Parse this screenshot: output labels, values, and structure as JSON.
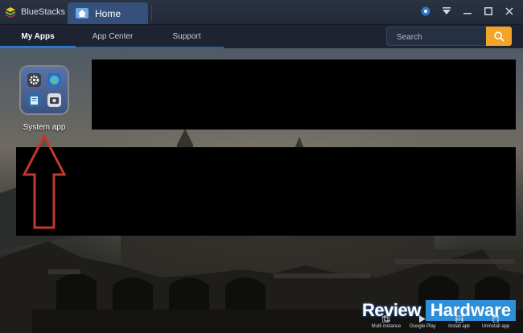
{
  "titlebar": {
    "app_name": "BlueStacks",
    "tab_label": "Home"
  },
  "nav": {
    "tabs": [
      {
        "label": "My Apps",
        "active": true
      },
      {
        "label": "App Center",
        "active": false
      },
      {
        "label": "Support",
        "active": false
      }
    ],
    "search_placeholder": "Search"
  },
  "apps": [
    {
      "label": "System app"
    }
  ],
  "watermark": {
    "part1": "Review",
    "part2": "Hardware"
  },
  "dock": {
    "items": [
      {
        "label": "Multi instance",
        "icon": "multi-instance-icon"
      },
      {
        "label": "Google Play",
        "icon": "google-play-icon"
      },
      {
        "label": "Install apk",
        "icon": "install-apk-icon"
      },
      {
        "label": "Uninstall app",
        "icon": "uninstall-app-icon"
      }
    ]
  },
  "colors": {
    "accent": "#2d78c8",
    "search_button": "#f3a52a",
    "arrow": "#c0392b"
  }
}
